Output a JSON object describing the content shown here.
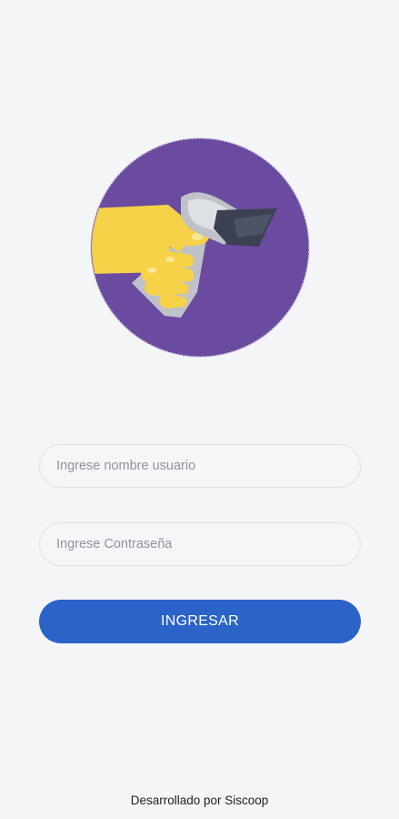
{
  "login": {
    "logo_icon": "barcode-scanner-in-hand-icon",
    "username_placeholder": "Ingrese nombre usuario",
    "password_placeholder": "Ingrese Contraseña",
    "submit_label": "INGRESAR"
  },
  "footer": {
    "credit": "Desarrollado por Siscoop"
  },
  "colors": {
    "background": "#f4f5f7",
    "logo_circle": "#6b4ba0",
    "hand": "#f5d247",
    "scanner_body": "#bfc2c8",
    "scanner_head": "#3b4150",
    "button": "#2b63c9",
    "button_text": "#ffffff"
  }
}
